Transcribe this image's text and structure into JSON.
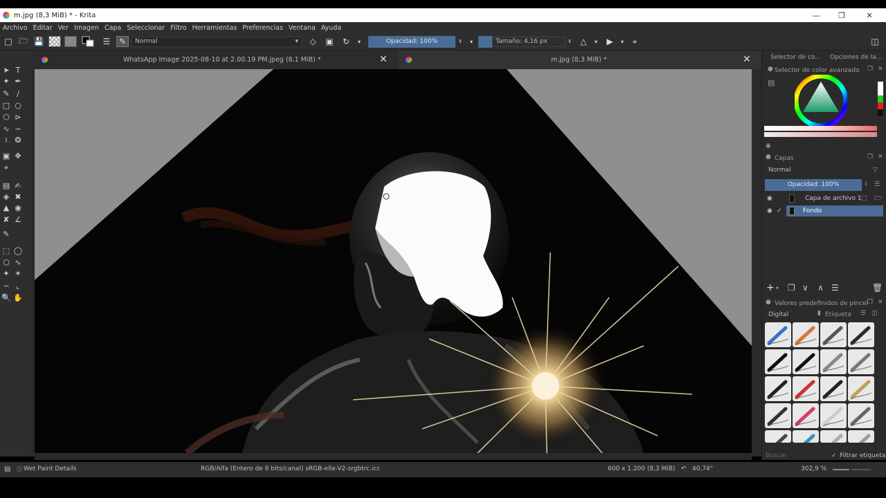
{
  "window": {
    "title": "m.jpg (8,3 MiB) * - Krita",
    "minimize_icon": "minimize-icon",
    "maximize_icon": "maximize-icon",
    "close_icon": "close-icon"
  },
  "menu": [
    "Archivo",
    "Editar",
    "Ver",
    "Imagen",
    "Capa",
    "Seleccionar",
    "Filtro",
    "Herramientas",
    "Preferencias",
    "Ventana",
    "Ayuda"
  ],
  "toolbar": {
    "blend_mode": "Normal",
    "opacity": "Opacidad: 100%",
    "size": "Tamaño: 4,16 px"
  },
  "documents": [
    {
      "title": "WhatsApp Image 2025-08-10 at 2.00.19 PM.jpeg (8,1 MiB) *"
    },
    {
      "title": "m.jpg (8,3 MiB) *"
    }
  ],
  "docker": {
    "tabs": [
      "Selector de co...",
      "Opciones de la..."
    ],
    "color_selector_title": "Selector de color avanzado",
    "layers_title": "Capas",
    "layers_blend": "Normal",
    "layers_opacity": "Opacidad:  100%",
    "layers": [
      {
        "name": "Capa de archivo 1",
        "active": false
      },
      {
        "name": "Fondo",
        "active": true
      }
    ],
    "brushes_title": "Valores predefinidos de pincel",
    "brush_category": "Digital",
    "brush_tag": "Etiqueta",
    "search_placeholder": "Buscar",
    "filter_label": "Filtrar etiqueta"
  },
  "status": {
    "left": "Wet Paint Details",
    "color_space": "RGB/Alfa (Entero de 8 bits/canal)  sRGB-elle-V2-srgbtrc.icc",
    "dimensions": "600 x 1.200 (8,3 MiB)",
    "rotation": "40,74°",
    "zoom": "302,9 %"
  },
  "colors": {
    "selection_blue": "#4a6c96",
    "panel": "#2e2e2e",
    "canvas_bg": "#8c8c8c"
  }
}
